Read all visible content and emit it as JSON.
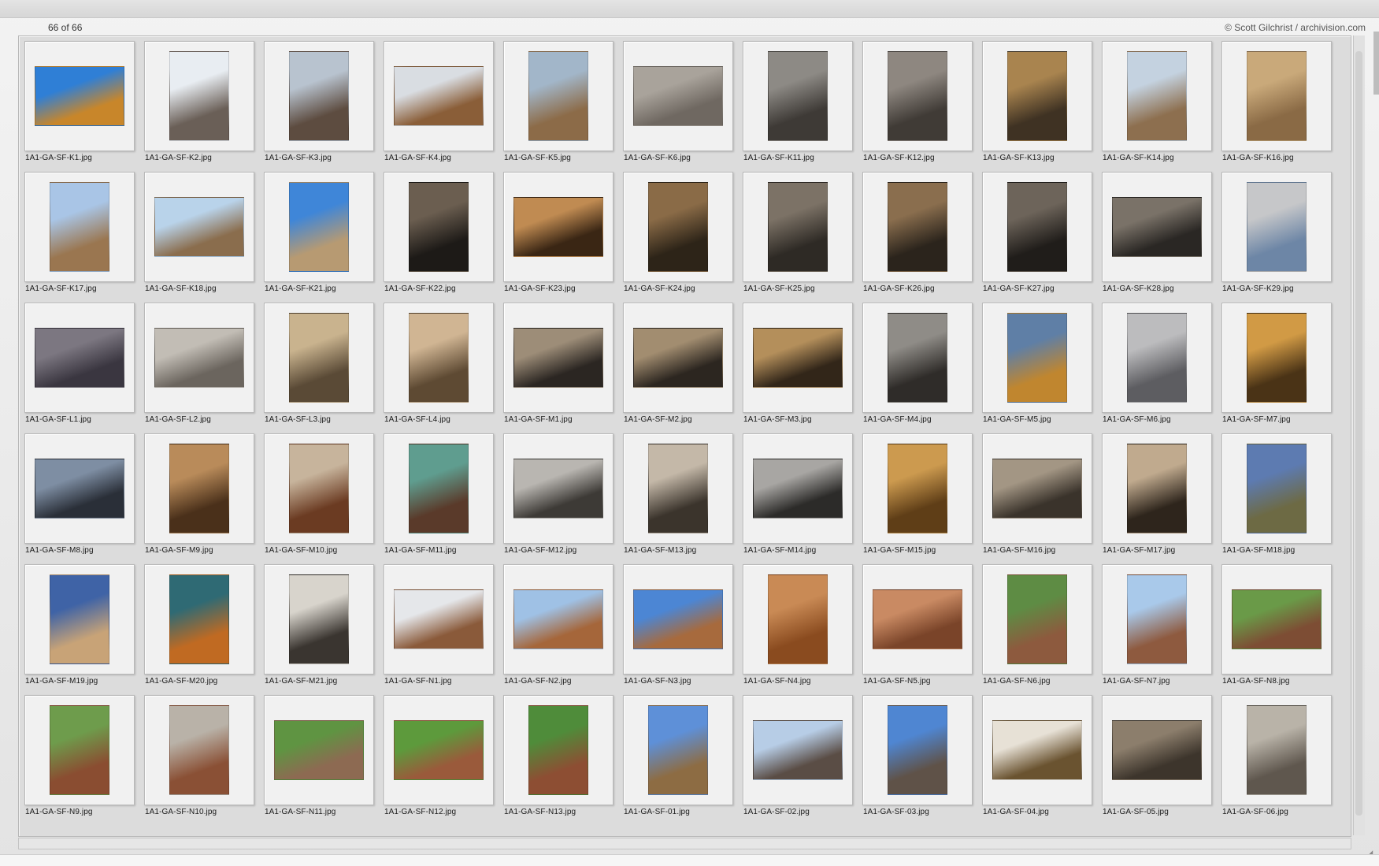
{
  "header": {
    "count": "66 of 66",
    "credit": "© Scott Gilchrist / archivision.com"
  },
  "items": [
    {
      "file": "1A1-GA-SF-K1.jpg",
      "icon": "photo-icon",
      "shape": "land",
      "colors": [
        "#2f7fd6",
        "#c8862a"
      ]
    },
    {
      "file": "1A1-GA-SF-K2.jpg",
      "icon": "photo-icon",
      "shape": "port",
      "colors": [
        "#e8edf2",
        "#6a5f57"
      ]
    },
    {
      "file": "1A1-GA-SF-K3.jpg",
      "icon": "photo-icon",
      "shape": "port",
      "colors": [
        "#b8c3cf",
        "#5d4c40"
      ]
    },
    {
      "file": "1A1-GA-SF-K4.jpg",
      "icon": "photo-icon",
      "shape": "land",
      "colors": [
        "#d9dde2",
        "#8a5e38"
      ]
    },
    {
      "file": "1A1-GA-SF-K5.jpg",
      "icon": "photo-icon",
      "shape": "port",
      "colors": [
        "#a2b6c9",
        "#8c6b48"
      ]
    },
    {
      "file": "1A1-GA-SF-K6.jpg",
      "icon": "photo-icon",
      "shape": "land",
      "colors": [
        "#a9a39b",
        "#6f6861"
      ]
    },
    {
      "file": "1A1-GA-SF-K11.jpg",
      "icon": "photo-icon",
      "shape": "port",
      "colors": [
        "#8d8a85",
        "#3e3a36"
      ]
    },
    {
      "file": "1A1-GA-SF-K12.jpg",
      "icon": "photo-icon",
      "shape": "port",
      "colors": [
        "#8e8780",
        "#403b36"
      ]
    },
    {
      "file": "1A1-GA-SF-K13.jpg",
      "icon": "photo-icon",
      "shape": "port",
      "colors": [
        "#a9844f",
        "#3f3223"
      ]
    },
    {
      "file": "1A1-GA-SF-K14.jpg",
      "icon": "photo-icon",
      "shape": "port",
      "colors": [
        "#c4d2e0",
        "#8d6f4f"
      ]
    },
    {
      "file": "1A1-GA-SF-K16.jpg",
      "icon": "photo-icon",
      "shape": "port",
      "colors": [
        "#c9a97a",
        "#8a6a45"
      ]
    },
    {
      "file": "1A1-GA-SF-K17.jpg",
      "icon": "photo-icon",
      "shape": "port",
      "colors": [
        "#a9c5e6",
        "#9a7650"
      ]
    },
    {
      "file": "1A1-GA-SF-K18.jpg",
      "icon": "photo-icon",
      "shape": "land",
      "colors": [
        "#b9d3ea",
        "#8a6d4d"
      ]
    },
    {
      "file": "1A1-GA-SF-K21.jpg",
      "icon": "photo-icon",
      "shape": "port",
      "colors": [
        "#3f86d8",
        "#b79a72"
      ]
    },
    {
      "file": "1A1-GA-SF-K22.jpg",
      "icon": "photo-icon",
      "shape": "port",
      "colors": [
        "#6b5e50",
        "#1d1a17"
      ]
    },
    {
      "file": "1A1-GA-SF-K23.jpg",
      "icon": "photo-icon",
      "shape": "land",
      "colors": [
        "#c08b52",
        "#3a2614"
      ]
    },
    {
      "file": "1A1-GA-SF-K24.jpg",
      "icon": "photo-icon",
      "shape": "port",
      "colors": [
        "#8a6b47",
        "#2d2418"
      ]
    },
    {
      "file": "1A1-GA-SF-K25.jpg",
      "icon": "photo-icon",
      "shape": "port",
      "colors": [
        "#7c7266",
        "#2e2a25"
      ]
    },
    {
      "file": "1A1-GA-SF-K26.jpg",
      "icon": "photo-icon",
      "shape": "port",
      "colors": [
        "#8a6e4e",
        "#2b241c"
      ]
    },
    {
      "file": "1A1-GA-SF-K27.jpg",
      "icon": "photo-icon",
      "shape": "port",
      "colors": [
        "#6d645a",
        "#201d1a"
      ]
    },
    {
      "file": "1A1-GA-SF-K28.jpg",
      "icon": "photo-icon",
      "shape": "land",
      "colors": [
        "#7a7268",
        "#2a2724"
      ]
    },
    {
      "file": "1A1-GA-SF-K29.jpg",
      "icon": "photo-icon",
      "shape": "port",
      "colors": [
        "#c6c7c9",
        "#6d86a6"
      ]
    },
    {
      "file": "1A1-GA-SF-L1.jpg",
      "icon": "photo-icon",
      "shape": "land",
      "colors": [
        "#7c7781",
        "#3a3640"
      ]
    },
    {
      "file": "1A1-GA-SF-L2.jpg",
      "icon": "photo-icon",
      "shape": "land",
      "colors": [
        "#c2bdb5",
        "#6b655e"
      ]
    },
    {
      "file": "1A1-GA-SF-L3.jpg",
      "icon": "photo-icon",
      "shape": "port",
      "colors": [
        "#c9b38e",
        "#5a4a36"
      ]
    },
    {
      "file": "1A1-GA-SF-L4.jpg",
      "icon": "photo-icon",
      "shape": "port",
      "colors": [
        "#d0b593",
        "#5e4a33"
      ]
    },
    {
      "file": "1A1-GA-SF-M1.jpg",
      "icon": "photo-icon",
      "shape": "land",
      "colors": [
        "#9d8d78",
        "#2b2622"
      ]
    },
    {
      "file": "1A1-GA-SF-M2.jpg",
      "icon": "photo-icon",
      "shape": "land",
      "colors": [
        "#a28d70",
        "#2c2620"
      ]
    },
    {
      "file": "1A1-GA-SF-M3.jpg",
      "icon": "photo-icon",
      "shape": "land",
      "colors": [
        "#b48f5b",
        "#322619"
      ]
    },
    {
      "file": "1A1-GA-SF-M4.jpg",
      "icon": "photo-icon",
      "shape": "port",
      "colors": [
        "#8f8c87",
        "#2f2c29"
      ]
    },
    {
      "file": "1A1-GA-SF-M5.jpg",
      "icon": "photo-icon",
      "shape": "port",
      "colors": [
        "#5f7fa6",
        "#c0862f"
      ]
    },
    {
      "file": "1A1-GA-SF-M6.jpg",
      "icon": "photo-icon",
      "shape": "port",
      "colors": [
        "#bcbcbe",
        "#5d5d61"
      ]
    },
    {
      "file": "1A1-GA-SF-M7.jpg",
      "icon": "photo-icon",
      "shape": "port",
      "colors": [
        "#d19a45",
        "#4a3316"
      ]
    },
    {
      "file": "1A1-GA-SF-M8.jpg",
      "icon": "photo-icon",
      "shape": "land",
      "colors": [
        "#7e8ea3",
        "#2a2f38"
      ]
    },
    {
      "file": "1A1-GA-SF-M9.jpg",
      "icon": "photo-icon",
      "shape": "port",
      "colors": [
        "#b98b5a",
        "#4a301a"
      ]
    },
    {
      "file": "1A1-GA-SF-M10.jpg",
      "icon": "photo-icon",
      "shape": "port",
      "colors": [
        "#c7b49c",
        "#6b3b22"
      ]
    },
    {
      "file": "1A1-GA-SF-M11.jpg",
      "icon": "photo-icon",
      "shape": "port",
      "colors": [
        "#5f9d8f",
        "#5a3a2a"
      ]
    },
    {
      "file": "1A1-GA-SF-M12.jpg",
      "icon": "photo-icon",
      "shape": "land",
      "colors": [
        "#b9b6b1",
        "#3d3a36"
      ]
    },
    {
      "file": "1A1-GA-SF-M13.jpg",
      "icon": "photo-icon",
      "shape": "port",
      "colors": [
        "#c4b8a8",
        "#3b342c"
      ]
    },
    {
      "file": "1A1-GA-SF-M14.jpg",
      "icon": "photo-icon",
      "shape": "land",
      "colors": [
        "#a8a6a3",
        "#2c2b29"
      ]
    },
    {
      "file": "1A1-GA-SF-M15.jpg",
      "icon": "photo-icon",
      "shape": "port",
      "colors": [
        "#cc9a4f",
        "#5f3e17"
      ]
    },
    {
      "file": "1A1-GA-SF-M16.jpg",
      "icon": "photo-icon",
      "shape": "land",
      "colors": [
        "#a39684",
        "#3a332b"
      ]
    },
    {
      "file": "1A1-GA-SF-M17.jpg",
      "icon": "photo-icon",
      "shape": "port",
      "colors": [
        "#c0aa8e",
        "#2e251c"
      ]
    },
    {
      "file": "1A1-GA-SF-M18.jpg",
      "icon": "photo-icon",
      "shape": "port",
      "colors": [
        "#5d7bb1",
        "#6d6a44"
      ]
    },
    {
      "file": "1A1-GA-SF-M19.jpg",
      "icon": "photo-icon",
      "shape": "port",
      "colors": [
        "#3f63a6",
        "#c8a377"
      ]
    },
    {
      "file": "1A1-GA-SF-M20.jpg",
      "icon": "photo-icon",
      "shape": "port",
      "colors": [
        "#2f6a74",
        "#c06a22"
      ]
    },
    {
      "file": "1A1-GA-SF-M21.jpg",
      "icon": "photo-icon",
      "shape": "port",
      "colors": [
        "#d8d4cc",
        "#3a3530"
      ]
    },
    {
      "file": "1A1-GA-SF-N1.jpg",
      "icon": "photo-icon",
      "shape": "land",
      "colors": [
        "#e5e7ea",
        "#8a5a3a"
      ]
    },
    {
      "file": "1A1-GA-SF-N2.jpg",
      "icon": "photo-icon",
      "shape": "land",
      "colors": [
        "#9fc1e5",
        "#a5663a"
      ]
    },
    {
      "file": "1A1-GA-SF-N3.jpg",
      "icon": "photo-icon",
      "shape": "land",
      "colors": [
        "#4c86d4",
        "#a76a3d"
      ]
    },
    {
      "file": "1A1-GA-SF-N4.jpg",
      "icon": "photo-icon",
      "shape": "port",
      "colors": [
        "#c98a55",
        "#8a4b1f"
      ]
    },
    {
      "file": "1A1-GA-SF-N5.jpg",
      "icon": "photo-icon",
      "shape": "land",
      "colors": [
        "#c98a63",
        "#7a4429"
      ]
    },
    {
      "file": "1A1-GA-SF-N6.jpg",
      "icon": "photo-icon",
      "shape": "port",
      "colors": [
        "#5e8c44",
        "#8d5a3e"
      ]
    },
    {
      "file": "1A1-GA-SF-N7.jpg",
      "icon": "photo-icon",
      "shape": "port",
      "colors": [
        "#a9c9ea",
        "#8e5a3f"
      ]
    },
    {
      "file": "1A1-GA-SF-N8.jpg",
      "icon": "photo-icon",
      "shape": "land",
      "colors": [
        "#6a9a48",
        "#7d4d34"
      ]
    },
    {
      "file": "1A1-GA-SF-N9.jpg",
      "icon": "photo-icon",
      "shape": "port",
      "colors": [
        "#6e9c4c",
        "#8a4d31"
      ]
    },
    {
      "file": "1A1-GA-SF-N10.jpg",
      "icon": "photo-icon",
      "shape": "port",
      "colors": [
        "#b9b2a8",
        "#8a5035"
      ]
    },
    {
      "file": "1A1-GA-SF-N11.jpg",
      "icon": "photo-icon",
      "shape": "land",
      "colors": [
        "#5f9442",
        "#8d6a52"
      ]
    },
    {
      "file": "1A1-GA-SF-N12.jpg",
      "icon": "photo-icon",
      "shape": "land",
      "colors": [
        "#5d9a3c",
        "#9a5a3b"
      ]
    },
    {
      "file": "1A1-GA-SF-N13.jpg",
      "icon": "photo-icon",
      "shape": "port",
      "colors": [
        "#4f8c3a",
        "#8d4e33"
      ]
    },
    {
      "file": "1A1-GA-SF-01.jpg",
      "icon": "photo-icon",
      "shape": "port",
      "colors": [
        "#5e90d8",
        "#8d6c43"
      ]
    },
    {
      "file": "1A1-GA-SF-02.jpg",
      "icon": "photo-icon",
      "shape": "land",
      "colors": [
        "#b7cde6",
        "#5a4d45"
      ]
    },
    {
      "file": "1A1-GA-SF-03.jpg",
      "icon": "photo-icon",
      "shape": "port",
      "colors": [
        "#4f86d2",
        "#5f5248"
      ]
    },
    {
      "file": "1A1-GA-SF-04.jpg",
      "icon": "photo-icon",
      "shape": "land",
      "colors": [
        "#e7e1d6",
        "#6a5330"
      ]
    },
    {
      "file": "1A1-GA-SF-05.jpg",
      "icon": "photo-icon",
      "shape": "land",
      "colors": [
        "#8c7e6c",
        "#3d352c"
      ]
    },
    {
      "file": "1A1-GA-SF-06.jpg",
      "icon": "photo-icon",
      "shape": "port",
      "colors": [
        "#b9b3a8",
        "#5f574e"
      ]
    }
  ]
}
